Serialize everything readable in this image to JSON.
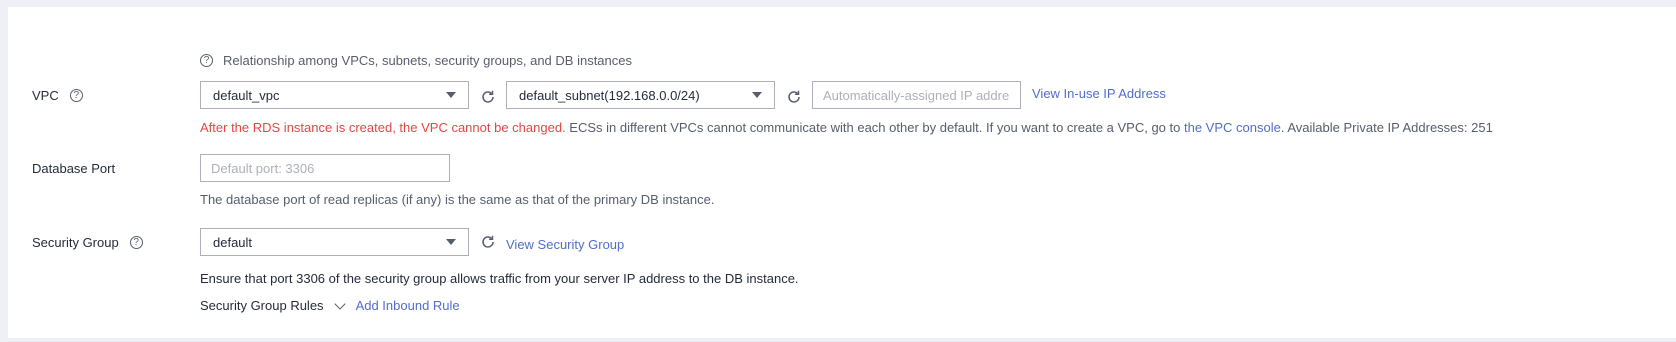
{
  "relationship_note": "Relationship among VPCs, subnets, security groups, and DB instances",
  "vpc": {
    "label": "VPC",
    "vpc_select_value": "default_vpc",
    "subnet_select_value": "default_subnet(192.168.0.0/24)",
    "ip_placeholder": "Automatically-assigned IP address",
    "view_ip_link": "View In-use IP Address",
    "warning_red": "After the RDS instance is created, the VPC cannot be changed.",
    "warning_text": " ECSs in different VPCs cannot communicate with each other by default. If you want to create a VPC, go to ",
    "console_link": "the VPC console",
    "available_text": ". Available Private IP Addresses: 251"
  },
  "database_port": {
    "label": "Database Port",
    "placeholder": "Default port: 3306",
    "hint": "The database port of read replicas (if any) is the same as that of the primary DB instance."
  },
  "security_group": {
    "label": "Security Group",
    "select_value": "default",
    "view_link": "View Security Group",
    "note": "Ensure that port 3306 of the security group allows traffic from your server IP address to the DB instance.",
    "rules_label": "Security Group Rules",
    "add_rule_link": "Add Inbound Rule"
  },
  "colors": {
    "link": "#526ecc",
    "warning": "#e54545",
    "border": "#adb0b8"
  },
  "icons": [
    "help-icon",
    "refresh-icon",
    "chevron-down-icon",
    "caret-down-icon"
  ]
}
